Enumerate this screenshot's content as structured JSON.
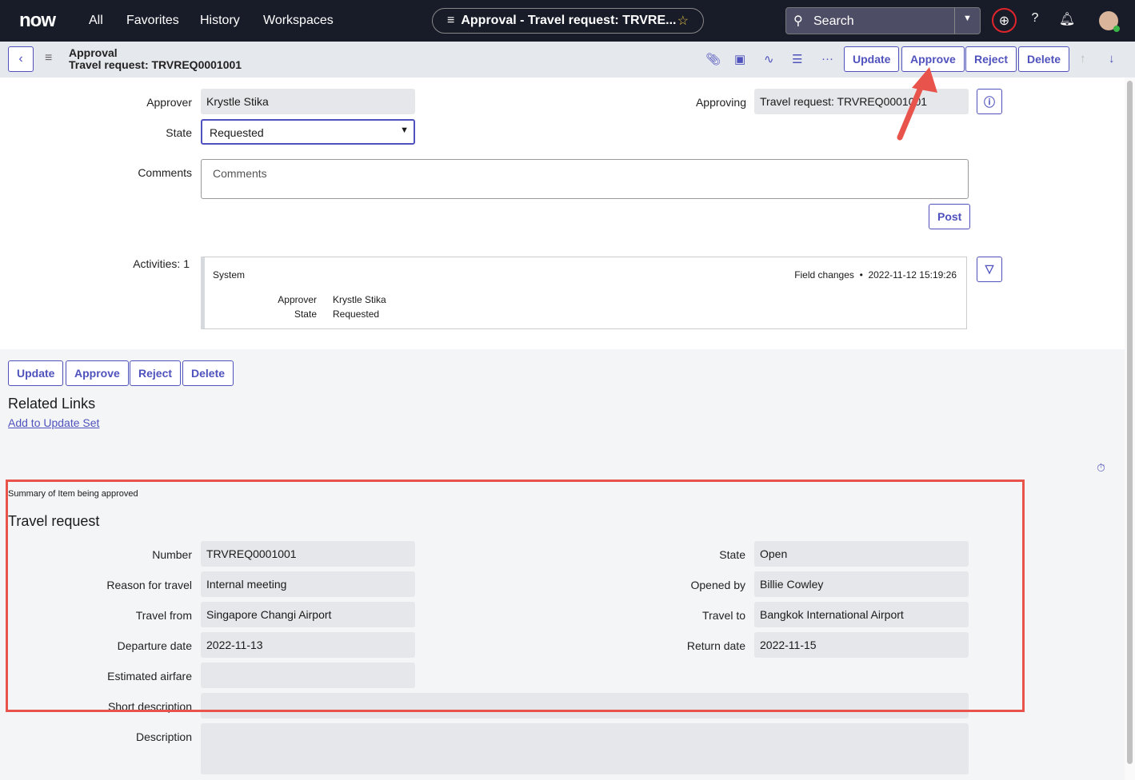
{
  "topbar": {
    "logo": "now",
    "nav": [
      "All",
      "Favorites",
      "History",
      "Workspaces"
    ],
    "context_title": "Approval - Travel request: TRVRE...",
    "search_placeholder": "Search"
  },
  "header": {
    "line1": "Approval",
    "line2": "Travel request: TRVREQ0001001",
    "buttons": [
      "Update",
      "Approve",
      "Reject",
      "Delete"
    ]
  },
  "form": {
    "approver_label": "Approver",
    "approver": "Krystle Stika",
    "state_label": "State",
    "state": "Requested",
    "approving_label": "Approving",
    "approving": "Travel request: TRVREQ0001001",
    "comments_label": "Comments",
    "comments_placeholder": "Comments",
    "post": "Post"
  },
  "activities": {
    "label": "Activities: 1",
    "author": "System",
    "type": "Field changes",
    "timestamp": "2022-11-12 15:19:26",
    "changes": [
      {
        "field": "Approver",
        "value": "Krystle Stika"
      },
      {
        "field": "State",
        "value": "Requested"
      }
    ]
  },
  "bottom_buttons": [
    "Update",
    "Approve",
    "Reject",
    "Delete"
  ],
  "related": {
    "title": "Related Links",
    "link": "Add to Update Set"
  },
  "summary": {
    "caption": "Summary of Item being approved",
    "title": "Travel request",
    "left": [
      {
        "label": "Number",
        "value": "TRVREQ0001001"
      },
      {
        "label": "Reason for travel",
        "value": "Internal meeting"
      },
      {
        "label": "Travel from",
        "value": "Singapore Changi Airport"
      },
      {
        "label": "Departure date",
        "value": "2022-11-13"
      },
      {
        "label": "Estimated airfare",
        "value": ""
      }
    ],
    "right": [
      {
        "label": "State",
        "value": "Open"
      },
      {
        "label": "Opened by",
        "value": "Billie Cowley"
      },
      {
        "label": "Travel to",
        "value": "Bangkok International Airport"
      },
      {
        "label": "Return date",
        "value": "2022-11-15"
      }
    ],
    "short_description_label": "Short description",
    "short_description": "",
    "description_label": "Description",
    "description": ""
  },
  "colors": {
    "accent": "#4f52bd",
    "annotation": "#e8534b",
    "topbar": "#181b28"
  }
}
